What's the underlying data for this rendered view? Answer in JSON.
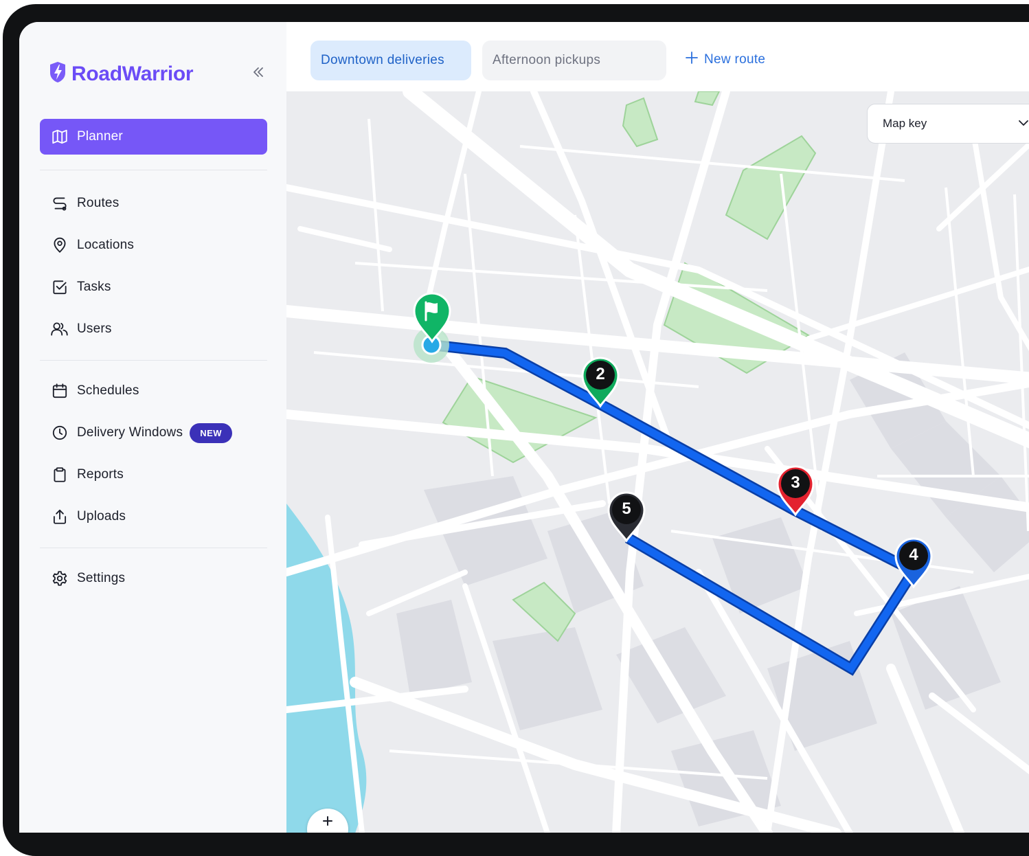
{
  "app": {
    "name": "RoadWarrior",
    "brand_color": "#6b4cf6"
  },
  "sidebar": {
    "collapse_icon": "chevrons-left-icon",
    "primary": {
      "label": "Planner",
      "icon": "map-icon"
    },
    "group1": [
      {
        "label": "Routes",
        "icon": "route-icon"
      },
      {
        "label": "Locations",
        "icon": "map-pin-icon"
      },
      {
        "label": "Tasks",
        "icon": "checkbox-icon"
      },
      {
        "label": "Users",
        "icon": "users-icon"
      }
    ],
    "group2": [
      {
        "label": "Schedules",
        "icon": "calendar-icon"
      },
      {
        "label": "Delivery Windows",
        "icon": "clock-icon",
        "badge": "NEW"
      },
      {
        "label": "Reports",
        "icon": "clipboard-icon"
      },
      {
        "label": "Uploads",
        "icon": "upload-icon"
      }
    ],
    "group3": [
      {
        "label": "Settings",
        "icon": "gear-icon"
      }
    ]
  },
  "tabs": [
    {
      "label": "Downtown deliveries",
      "active": true
    },
    {
      "label": "Afternoon pickups",
      "active": false
    }
  ],
  "new_route_label": "New route",
  "map": {
    "map_key_label": "Map key",
    "route_color": "#0b5de6",
    "stops": [
      {
        "label": "",
        "type": "start",
        "color": "#10b566",
        "icon": "flag-icon"
      },
      {
        "label": "2",
        "color": "#0faa5c"
      },
      {
        "label": "3",
        "color": "#e3222f"
      },
      {
        "label": "4",
        "color": "#1a63de"
      },
      {
        "label": "5",
        "color": "#2a2c33"
      }
    ]
  }
}
